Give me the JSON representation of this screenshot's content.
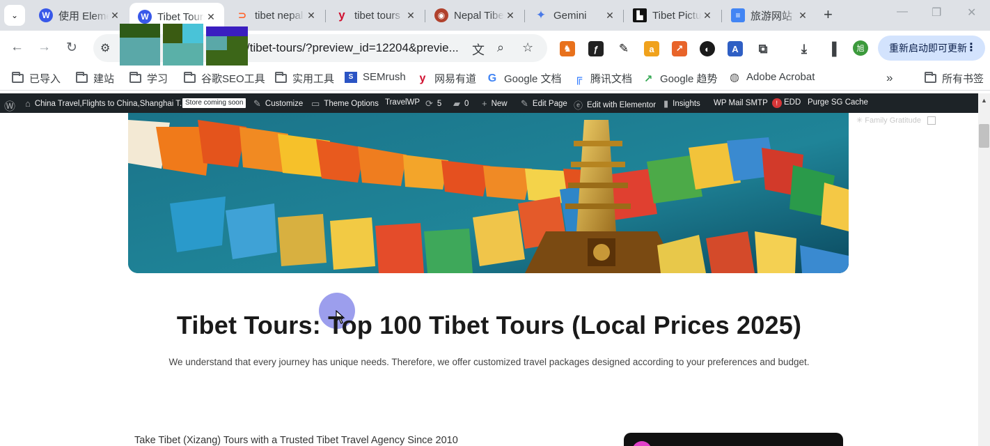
{
  "tabs": [
    {
      "title": "使用 Elementor",
      "favicon": "wordpress-icon",
      "active": false
    },
    {
      "title": "Tibet Tours",
      "favicon": "wordpress-icon",
      "active": true
    },
    {
      "title": "tibet nepal",
      "favicon": "semrush-icon",
      "active": false
    },
    {
      "title": "tibet tours",
      "favicon": "youdao-icon",
      "active": false
    },
    {
      "title": "Nepal Tibet",
      "favicon": "site-icon",
      "active": false
    },
    {
      "title": "Gemini",
      "favicon": "gemini-icon",
      "active": false
    },
    {
      "title": "Tibet Pictures",
      "favicon": "unsplash-icon",
      "active": false
    },
    {
      "title": "旅游网站",
      "favicon": "docs-icon",
      "active": false
    }
  ],
  "address_bar": {
    "url": "/tibet-tours/?preview_id=12204&previe..."
  },
  "update_button": {
    "label": "重新启动即可更新"
  },
  "avatar_initial": "旭",
  "bookmarks": [
    {
      "label": "已导入",
      "icon": "folder-icon"
    },
    {
      "label": "建站",
      "icon": "folder-icon"
    },
    {
      "label": "学习",
      "icon": "folder-icon"
    },
    {
      "label": "谷歌SEO工具",
      "icon": "folder-icon"
    },
    {
      "label": "实用工具",
      "icon": "folder-icon"
    },
    {
      "label": "SEMrush",
      "icon": "semrush-icon"
    },
    {
      "label": "网易有道",
      "icon": "youdao-icon"
    },
    {
      "label": "Google 文档",
      "icon": "google-icon"
    },
    {
      "label": "腾讯文档",
      "icon": "tencent-docs-icon"
    },
    {
      "label": "Google 趋势",
      "icon": "trends-icon"
    },
    {
      "label": "Adobe Acrobat",
      "icon": "acrobat-icon"
    },
    {
      "label": "所有书签",
      "icon": "folder-icon"
    }
  ],
  "admin_bar": {
    "site_name": "China Travel,Flights to China,Shanghai T...",
    "store_badge": "Store coming soon",
    "customize": "Customize",
    "theme_options": "Theme Options",
    "travelwp": "TravelWP",
    "updates_count": "5",
    "comments_count": "0",
    "new": "New",
    "edit_page": "Edit Page",
    "edit_elementor": "Edit with Elementor",
    "insights": "Insights",
    "wp_mail": "WP Mail SMTP",
    "wp_mail_alert": "!",
    "edd": "EDD",
    "purge": "Purge SG Cache"
  },
  "page": {
    "headline": "Tibet Tours: Top 100 Tibet Tours (Local Prices 2025)",
    "subline": "We understand that every journey has unique needs. Therefore, we offer customized travel packages designed according to your preferences and budget.",
    "section_label": "Take Tibet (Xizang) Tours with a Trusted Tibet Travel Agency Since 2010",
    "ghost_label": "Family Gratitude"
  }
}
